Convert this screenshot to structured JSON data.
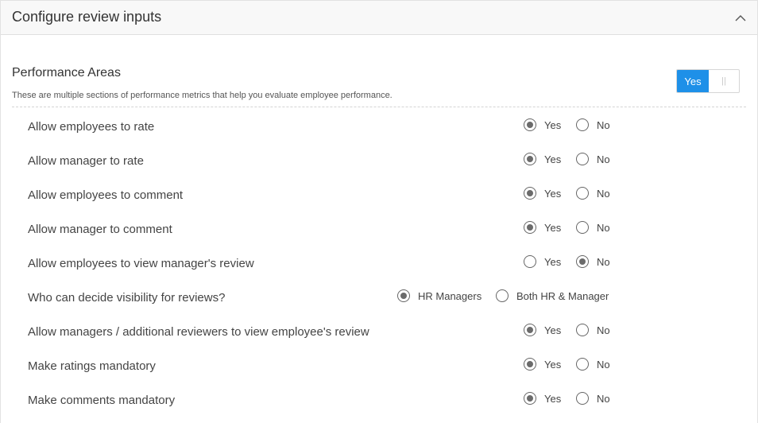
{
  "header": {
    "title": "Configure review inputs",
    "collapse_icon": "chevron-up-icon"
  },
  "section": {
    "title": "Performance Areas",
    "description": "These are multiple sections of performance metrics that help you evaluate employee performance.",
    "toggle": {
      "on_label": "Yes",
      "off_label": "||",
      "state": "on"
    }
  },
  "options": {
    "yes": "Yes",
    "no": "No",
    "hr_managers": "HR Managers",
    "both": "Both HR & Manager"
  },
  "rows": [
    {
      "label": "Allow employees to rate",
      "selected": "yes"
    },
    {
      "label": "Allow manager to rate",
      "selected": "yes"
    },
    {
      "label": "Allow employees to comment",
      "selected": "yes"
    },
    {
      "label": "Allow manager to comment",
      "selected": "yes"
    },
    {
      "label": "Allow employees to view manager's review",
      "selected": "no"
    },
    {
      "label": "Who can decide visibility for reviews?",
      "selected": "hr_managers"
    },
    {
      "label": "Allow managers / additional reviewers to view employee's review",
      "selected": "yes"
    },
    {
      "label": "Make ratings mandatory",
      "selected": "yes"
    },
    {
      "label": "Make comments mandatory",
      "selected": "yes"
    }
  ],
  "colors": {
    "accent": "#1e90e8",
    "radio_fill": "#6b6b6b"
  }
}
